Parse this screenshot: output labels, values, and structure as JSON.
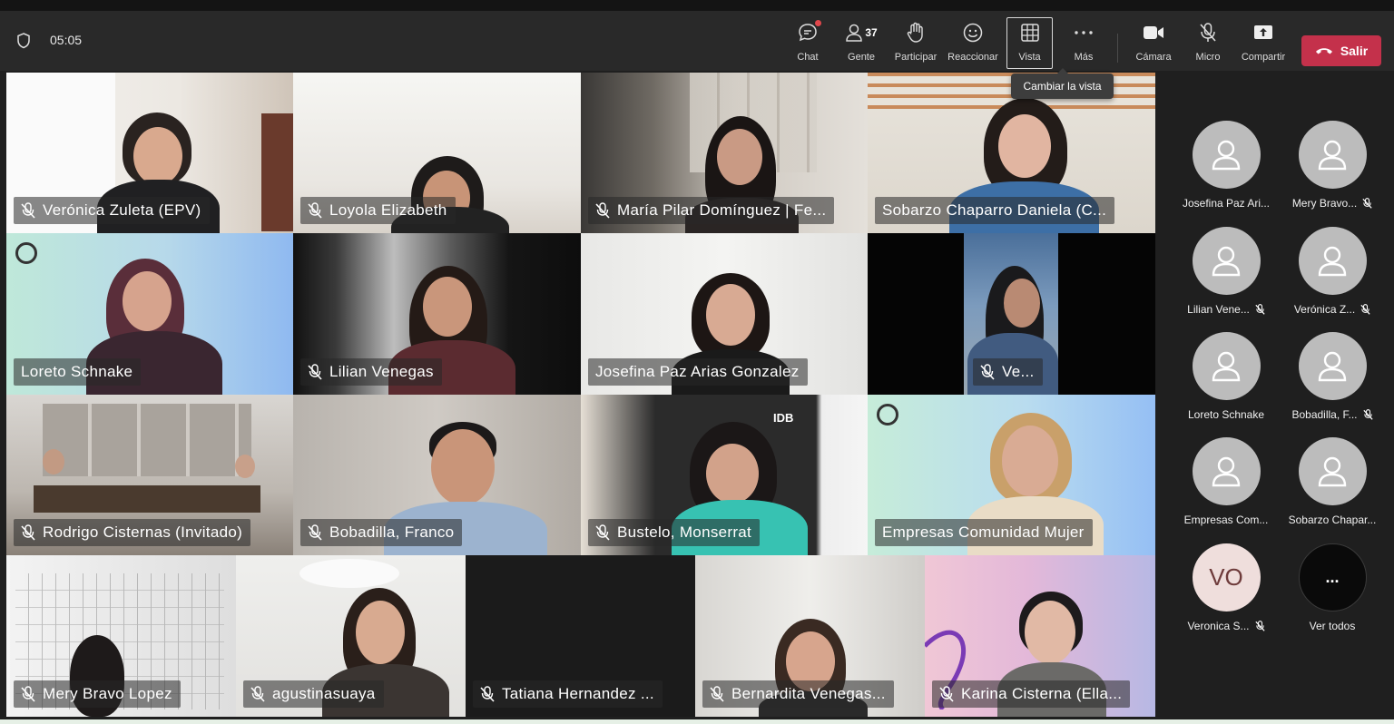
{
  "toolbar": {
    "timer": "05:05",
    "buttons": {
      "chat": "Chat",
      "people": "Gente",
      "people_count": "37",
      "raise": "Participar",
      "react": "Reaccionar",
      "view": "Vista",
      "more": "Más",
      "camera": "Cámara",
      "mic": "Micro",
      "share": "Compartir"
    },
    "leave": "Salir",
    "tooltip": "Cambiar la vista"
  },
  "tiles": [
    {
      "name": "Verónica Zuleta (EPV)"
    },
    {
      "name": "Loyola Elizabeth"
    },
    {
      "name": "María Pilar Domínguez | Fe..."
    },
    {
      "name": "Sobarzo Chaparro Daniela (C..."
    },
    {
      "name": "Loreto Schnake"
    },
    {
      "name": "Lilian Venegas"
    },
    {
      "name": "Josefina Paz Arias Gonzalez"
    },
    {
      "name": "Ve..."
    },
    {
      "name": "Rodrigo Cisternas (Invitado)"
    },
    {
      "name": "Bobadilla, Franco"
    },
    {
      "name": "Bustelo, Monserrat"
    },
    {
      "name": "Empresas Comunidad Mujer"
    },
    {
      "name": "Mery Bravo Lopez"
    },
    {
      "name": "agustinasuaya"
    },
    {
      "name": "Tatiana Hernandez ..."
    },
    {
      "name": "Bernardita Venegas..."
    },
    {
      "name": "Karina Cisterna (Ella..."
    }
  ],
  "idb_logo": "IDB",
  "sidebar": {
    "participants": [
      {
        "label": "Josefina Paz Ari..."
      },
      {
        "label": "Mery Bravo..."
      },
      {
        "label": "Lilian Vene..."
      },
      {
        "label": "Verónica Z..."
      },
      {
        "label": "Loreto Schnake"
      },
      {
        "label": "Bobadilla, F..."
      },
      {
        "label": "Empresas Com..."
      },
      {
        "label": "Sobarzo Chapar..."
      },
      {
        "label": "Veronica S...",
        "initials": "VO"
      }
    ],
    "see_all": "Ver todos",
    "see_all_glyph": "..."
  },
  "colors": {
    "leave": "#c4314b",
    "toolbar": "#292929",
    "avatar": "#bcbcbc"
  }
}
